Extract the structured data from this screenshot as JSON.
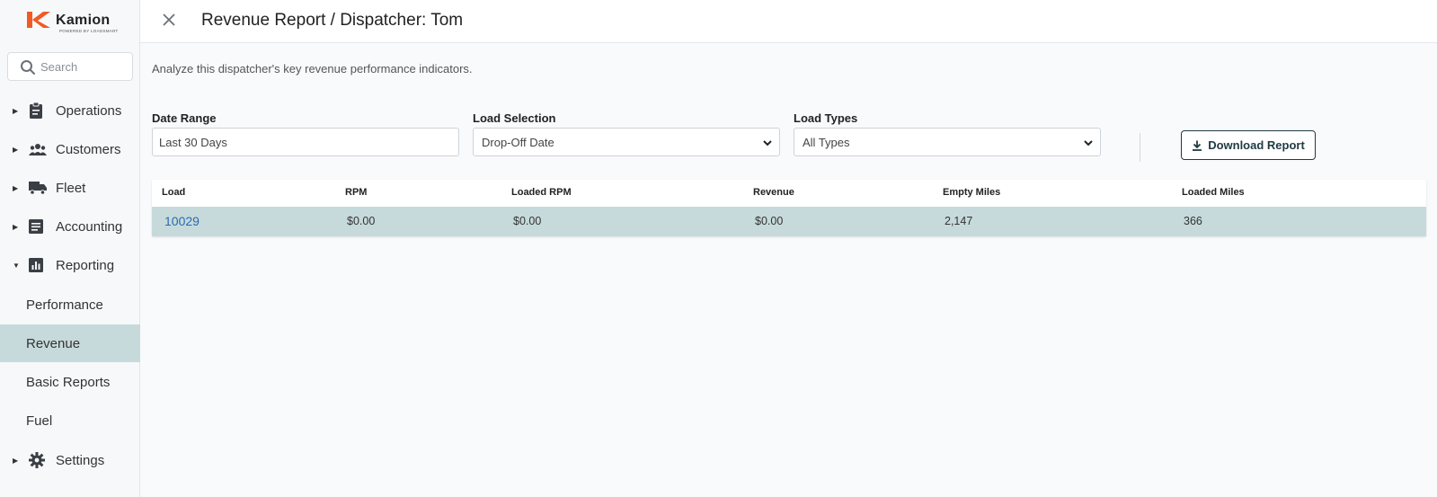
{
  "brand": {
    "name": "Kamion",
    "tagline": "POWERED BY LOADSMART",
    "accent": "#f15a22"
  },
  "search": {
    "placeholder": "Search"
  },
  "nav": {
    "operations": "Operations",
    "customers": "Customers",
    "fleet": "Fleet",
    "accounting": "Accounting",
    "reporting": "Reporting",
    "settings": "Settings"
  },
  "reporting_sub": {
    "performance": "Performance",
    "revenue": "Revenue",
    "basic_reports": "Basic Reports",
    "fuel": "Fuel"
  },
  "header": {
    "title": "Revenue Report / Dispatcher: Tom"
  },
  "subtitle": "Analyze this dispatcher's key revenue performance indicators.",
  "filters": {
    "date_range": {
      "label": "Date Range",
      "value": "Last 30 Days"
    },
    "load_selection": {
      "label": "Load Selection",
      "value": "Drop-Off Date"
    },
    "load_types": {
      "label": "Load Types",
      "value": "All Types"
    }
  },
  "download_label": "Download Report",
  "table": {
    "headers": {
      "load": "Load",
      "rpm": "RPM",
      "loaded_rpm": "Loaded RPM",
      "revenue": "Revenue",
      "empty_miles": "Empty Miles",
      "loaded_miles": "Loaded Miles"
    },
    "rows": [
      {
        "load": "10029",
        "rpm": "$0.00",
        "loaded_rpm": "$0.00",
        "revenue": "$0.00",
        "empty_miles": "2,147",
        "loaded_miles": "366"
      }
    ]
  },
  "colors": {
    "active_bg": "#c7dadb",
    "link": "#2a6bb0",
    "button_border": "#1f3a42"
  }
}
